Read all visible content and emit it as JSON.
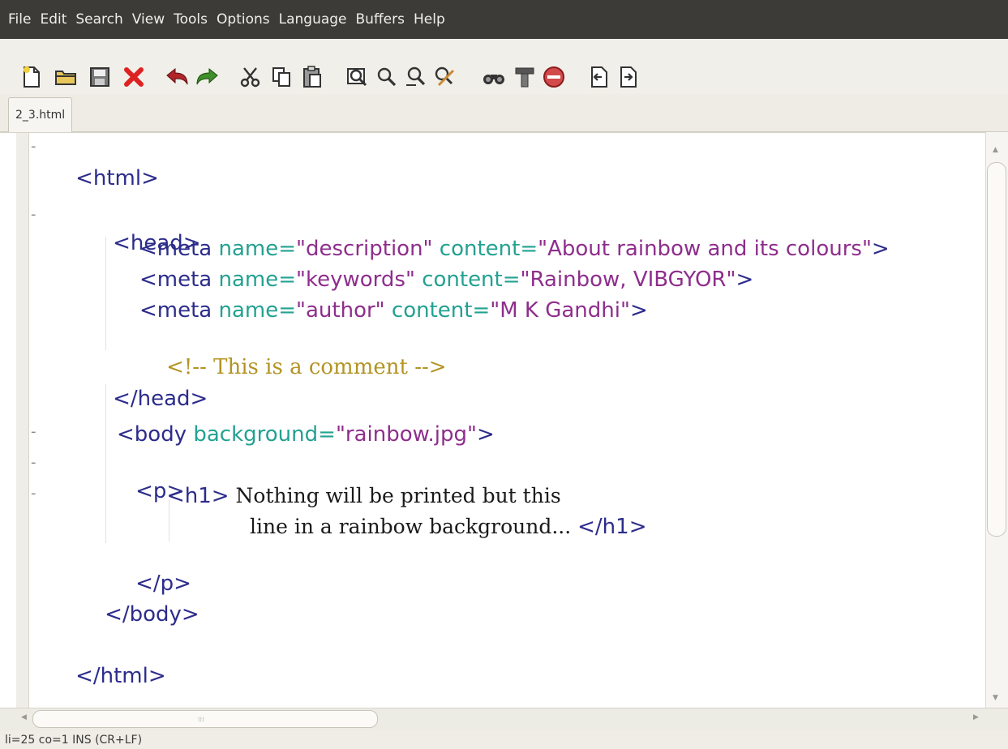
{
  "menubar": {
    "items": [
      {
        "label": "File"
      },
      {
        "label": "Edit"
      },
      {
        "label": "Search"
      },
      {
        "label": "View"
      },
      {
        "label": "Tools"
      },
      {
        "label": "Options"
      },
      {
        "label": "Language"
      },
      {
        "label": "Buffers"
      },
      {
        "label": "Help"
      }
    ]
  },
  "toolbar": {
    "buttons": [
      {
        "icon": "new-file-icon"
      },
      {
        "icon": "open-folder-icon"
      },
      {
        "icon": "save-icon"
      },
      {
        "icon": "close-icon"
      },
      {
        "icon": "undo-icon"
      },
      {
        "icon": "redo-icon"
      },
      {
        "icon": "cut-icon"
      },
      {
        "icon": "copy-icon"
      },
      {
        "icon": "paste-icon"
      },
      {
        "icon": "find-icon"
      },
      {
        "icon": "find-next-icon"
      },
      {
        "icon": "find-previous-icon"
      },
      {
        "icon": "replace-icon"
      },
      {
        "icon": "find-in-files-icon"
      },
      {
        "icon": "build-icon"
      },
      {
        "icon": "stop-icon"
      },
      {
        "icon": "previous-buffer-icon"
      },
      {
        "icon": "next-buffer-icon"
      }
    ]
  },
  "tabs": [
    {
      "label": "2_3.html"
    }
  ],
  "editor": {
    "colors": {
      "tag": "#2c2c8c",
      "attr": "#23a191",
      "value": "#8e2e8c",
      "comment": "#b39424",
      "text": "#1a1a1a"
    },
    "lines": {
      "l1": {
        "tag": "<html>"
      },
      "l3": {
        "tag": "<head>"
      },
      "l4": {
        "t1": "<meta ",
        "a1": "name=",
        "v1": "\"description\"",
        "sp": " ",
        "a2": "content=",
        "v2": "\"About rainbow and its colours\"",
        "t2": ">"
      },
      "l5": {
        "t1": "<meta ",
        "a1": "name=",
        "v1": "\"keywords\"",
        "sp": " ",
        "a2": "content=",
        "v2": "\"Rainbow, VIBGYOR\"",
        "t2": ">"
      },
      "l6": {
        "t1": "<meta ",
        "a1": "name=",
        "v1": "\"author\"",
        "sp": " ",
        "a2": "content=",
        "v2": "\"M K Gandhi\"",
        "t2": ">"
      },
      "l7": {
        "comment": "<!-- This is a comment -->"
      },
      "l8": {
        "tag": "</head>"
      },
      "l10": {
        "t1": "<body ",
        "a1": "background=",
        "v1": "\"rainbow.jpg\"",
        "t2": ">"
      },
      "l11": {
        "tag": "<p>"
      },
      "l12": {
        "t1": "<h1>",
        "text": " Nothing will be printed but this"
      },
      "l13": {
        "text": "line in a rainbow background... ",
        "t2": "</h1>"
      },
      "l14": {
        "tag": "</p>"
      },
      "l15": {
        "tag": "</body>"
      },
      "l17": {
        "tag": "</html>"
      }
    },
    "fold_marker": "-"
  },
  "statusbar": {
    "text": "li=25 co=1 INS (CR+LF)"
  }
}
